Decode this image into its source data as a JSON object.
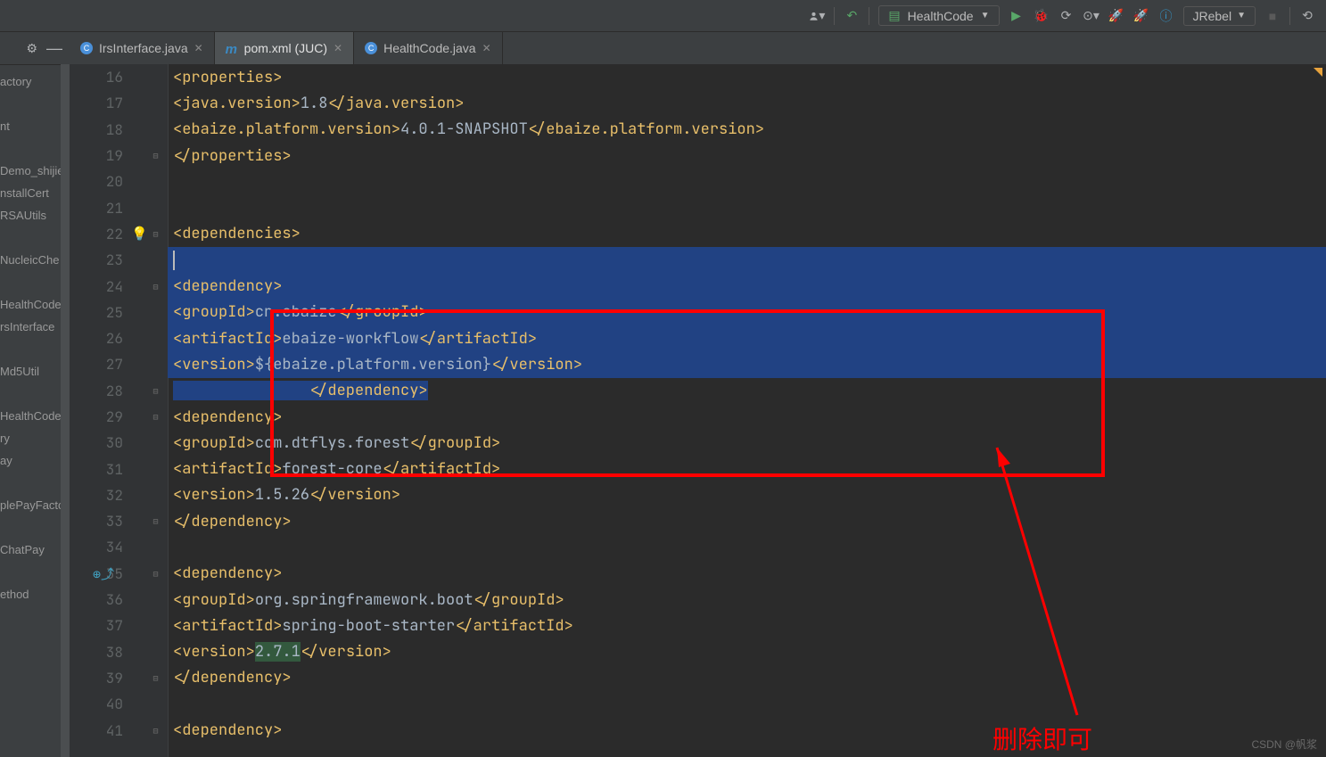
{
  "toolbar": {
    "run_config": "HealthCode",
    "jrebel": "JRebel"
  },
  "tabs": [
    {
      "label": "IrsInterface.java",
      "active": false,
      "icon": "#4a90d9"
    },
    {
      "label": "pom.xml (JUC)",
      "active": true,
      "icon": "#3b8ac4",
      "m": true
    },
    {
      "label": "HealthCode.java",
      "active": false,
      "icon": "#4a90d9"
    }
  ],
  "structure": [
    "actory",
    "",
    "nt",
    "",
    "Demo_shijie",
    "nstallCert",
    "RSAUtils",
    "",
    "NucleicChe",
    "",
    "HealthCode",
    "rsInterface",
    "",
    "Md5Util",
    "",
    "HealthCode",
    "ry",
    "ay",
    "",
    "plePayFacto",
    "",
    "ChatPay",
    "",
    "ethod"
  ],
  "lines": [
    {
      "n": "16",
      "i": 2,
      "seg": [
        [
          "<",
          "tag"
        ],
        [
          "properties",
          "tag"
        ],
        [
          ">",
          "tag"
        ]
      ]
    },
    {
      "n": "17",
      "i": 3,
      "seg": [
        [
          "<",
          "tag"
        ],
        [
          "java.version",
          "tag"
        ],
        [
          ">",
          "tag"
        ],
        [
          "1.8",
          "txt"
        ],
        [
          "</",
          "tag"
        ],
        [
          "java.version",
          "tag"
        ],
        [
          ">",
          "tag"
        ]
      ]
    },
    {
      "n": "18",
      "i": 3,
      "seg": [
        [
          "<",
          "tag"
        ],
        [
          "ebaize.platform.version",
          "tag"
        ],
        [
          ">",
          "tag"
        ],
        [
          "4.0.1-SNAPSHOT",
          "txt"
        ],
        [
          "</",
          "tag"
        ],
        [
          "ebaize.platform.version",
          "tag"
        ],
        [
          ">",
          "tag"
        ]
      ]
    },
    {
      "n": "19",
      "i": 2,
      "seg": [
        [
          "</",
          "tag"
        ],
        [
          "properties",
          "tag"
        ],
        [
          ">",
          "tag"
        ]
      ],
      "fold": "–"
    },
    {
      "n": "20",
      "i": 0,
      "seg": []
    },
    {
      "n": "21",
      "i": 0,
      "seg": []
    },
    {
      "n": "22",
      "i": 2,
      "seg": [
        [
          "<",
          "tag"
        ],
        [
          "dependencies",
          "tag"
        ],
        [
          ">",
          "tag"
        ]
      ],
      "bulb": true,
      "fold": "–"
    },
    {
      "n": "23",
      "i": 0,
      "seg": [],
      "sel": true,
      "caret": true
    },
    {
      "n": "24",
      "i": 3,
      "seg": [
        [
          "<",
          "tag"
        ],
        [
          "dependency",
          "tag"
        ],
        [
          ">",
          "tag"
        ]
      ],
      "sel": true,
      "fold": "–"
    },
    {
      "n": "25",
      "i": 4,
      "seg": [
        [
          "<",
          "tag"
        ],
        [
          "groupId",
          "tag"
        ],
        [
          ">",
          "tag"
        ],
        [
          "cn.ebaize",
          "txt"
        ],
        [
          "</",
          "tag"
        ],
        [
          "groupId",
          "tag"
        ],
        [
          ">",
          "tag"
        ]
      ],
      "sel": true
    },
    {
      "n": "26",
      "i": 4,
      "seg": [
        [
          "<",
          "tag"
        ],
        [
          "artifactId",
          "tag"
        ],
        [
          ">",
          "tag"
        ],
        [
          "ebaize-workflow",
          "txt"
        ],
        [
          "</",
          "tag"
        ],
        [
          "artifactId",
          "tag"
        ],
        [
          ">",
          "tag"
        ]
      ],
      "sel": true
    },
    {
      "n": "27",
      "i": 4,
      "seg": [
        [
          "<",
          "tag"
        ],
        [
          "version",
          "tag"
        ],
        [
          ">",
          "tag"
        ],
        [
          "${ebaize.platform.version}",
          "txt"
        ],
        [
          "</",
          "tag"
        ],
        [
          "version",
          "tag"
        ],
        [
          ">",
          "tag"
        ]
      ],
      "sel": true
    },
    {
      "n": "28",
      "i": 3,
      "seg": [
        [
          "</",
          "tag"
        ],
        [
          "dependency",
          "tag"
        ],
        [
          ">",
          "tag"
        ]
      ],
      "sel": true,
      "fold": "–",
      "selpartial": true
    },
    {
      "n": "29",
      "i": 3,
      "seg": [
        [
          "<",
          "tag"
        ],
        [
          "dependency",
          "tag"
        ],
        [
          ">",
          "tag"
        ]
      ],
      "fold": "–"
    },
    {
      "n": "30",
      "i": 4,
      "seg": [
        [
          "<",
          "tag"
        ],
        [
          "groupId",
          "tag"
        ],
        [
          ">",
          "tag"
        ],
        [
          "com.dtflys.forest",
          "txt"
        ],
        [
          "</",
          "tag"
        ],
        [
          "groupId",
          "tag"
        ],
        [
          ">",
          "tag"
        ]
      ]
    },
    {
      "n": "31",
      "i": 4,
      "seg": [
        [
          "<",
          "tag"
        ],
        [
          "artifactId",
          "tag"
        ],
        [
          ">",
          "tag"
        ],
        [
          "forest-core",
          "txt"
        ],
        [
          "</",
          "tag"
        ],
        [
          "artifactId",
          "tag"
        ],
        [
          ">",
          "tag"
        ]
      ]
    },
    {
      "n": "32",
      "i": 4,
      "seg": [
        [
          "<",
          "tag"
        ],
        [
          "version",
          "tag"
        ],
        [
          ">",
          "tag"
        ],
        [
          "1.5.26",
          "txt"
        ],
        [
          "</",
          "tag"
        ],
        [
          "version",
          "tag"
        ],
        [
          ">",
          "tag"
        ]
      ]
    },
    {
      "n": "33",
      "i": 3,
      "seg": [
        [
          "</",
          "tag"
        ],
        [
          "dependency",
          "tag"
        ],
        [
          ">",
          "tag"
        ]
      ],
      "fold": "–"
    },
    {
      "n": "34",
      "i": 0,
      "seg": []
    },
    {
      "n": "35",
      "i": 3,
      "seg": [
        [
          "<",
          "tag"
        ],
        [
          "dependency",
          "tag"
        ],
        [
          ">",
          "tag"
        ]
      ],
      "fold": "–",
      "nav": true
    },
    {
      "n": "36",
      "i": 4,
      "seg": [
        [
          "<",
          "tag"
        ],
        [
          "groupId",
          "tag"
        ],
        [
          ">",
          "tag"
        ],
        [
          "org.springframework.boot",
          "txt"
        ],
        [
          "</",
          "tag"
        ],
        [
          "groupId",
          "tag"
        ],
        [
          ">",
          "tag"
        ]
      ]
    },
    {
      "n": "37",
      "i": 4,
      "seg": [
        [
          "<",
          "tag"
        ],
        [
          "artifactId",
          "tag"
        ],
        [
          ">",
          "tag"
        ],
        [
          "spring-boot-starter",
          "txt"
        ],
        [
          "</",
          "tag"
        ],
        [
          "artifactId",
          "tag"
        ],
        [
          ">",
          "tag"
        ]
      ]
    },
    {
      "n": "38",
      "i": 4,
      "seg": [
        [
          "<",
          "tag"
        ],
        [
          "version",
          "tag"
        ],
        [
          ">",
          "tag"
        ],
        [
          "2.7.1",
          "txt",
          "hl"
        ],
        [
          "</",
          "tag"
        ],
        [
          "version",
          "tag"
        ],
        [
          ">",
          "tag"
        ]
      ]
    },
    {
      "n": "39",
      "i": 3,
      "seg": [
        [
          "</",
          "tag"
        ],
        [
          "dependency",
          "tag"
        ],
        [
          ">",
          "tag"
        ]
      ],
      "fold": "–"
    },
    {
      "n": "40",
      "i": 0,
      "seg": []
    },
    {
      "n": "41",
      "i": 3,
      "seg": [
        [
          "<",
          "tag"
        ],
        [
          "dependency",
          "tag"
        ],
        [
          ">",
          "tag"
        ]
      ],
      "fold": "–"
    }
  ],
  "annotation": "删除即可",
  "watermark": "CSDN @帆浆"
}
